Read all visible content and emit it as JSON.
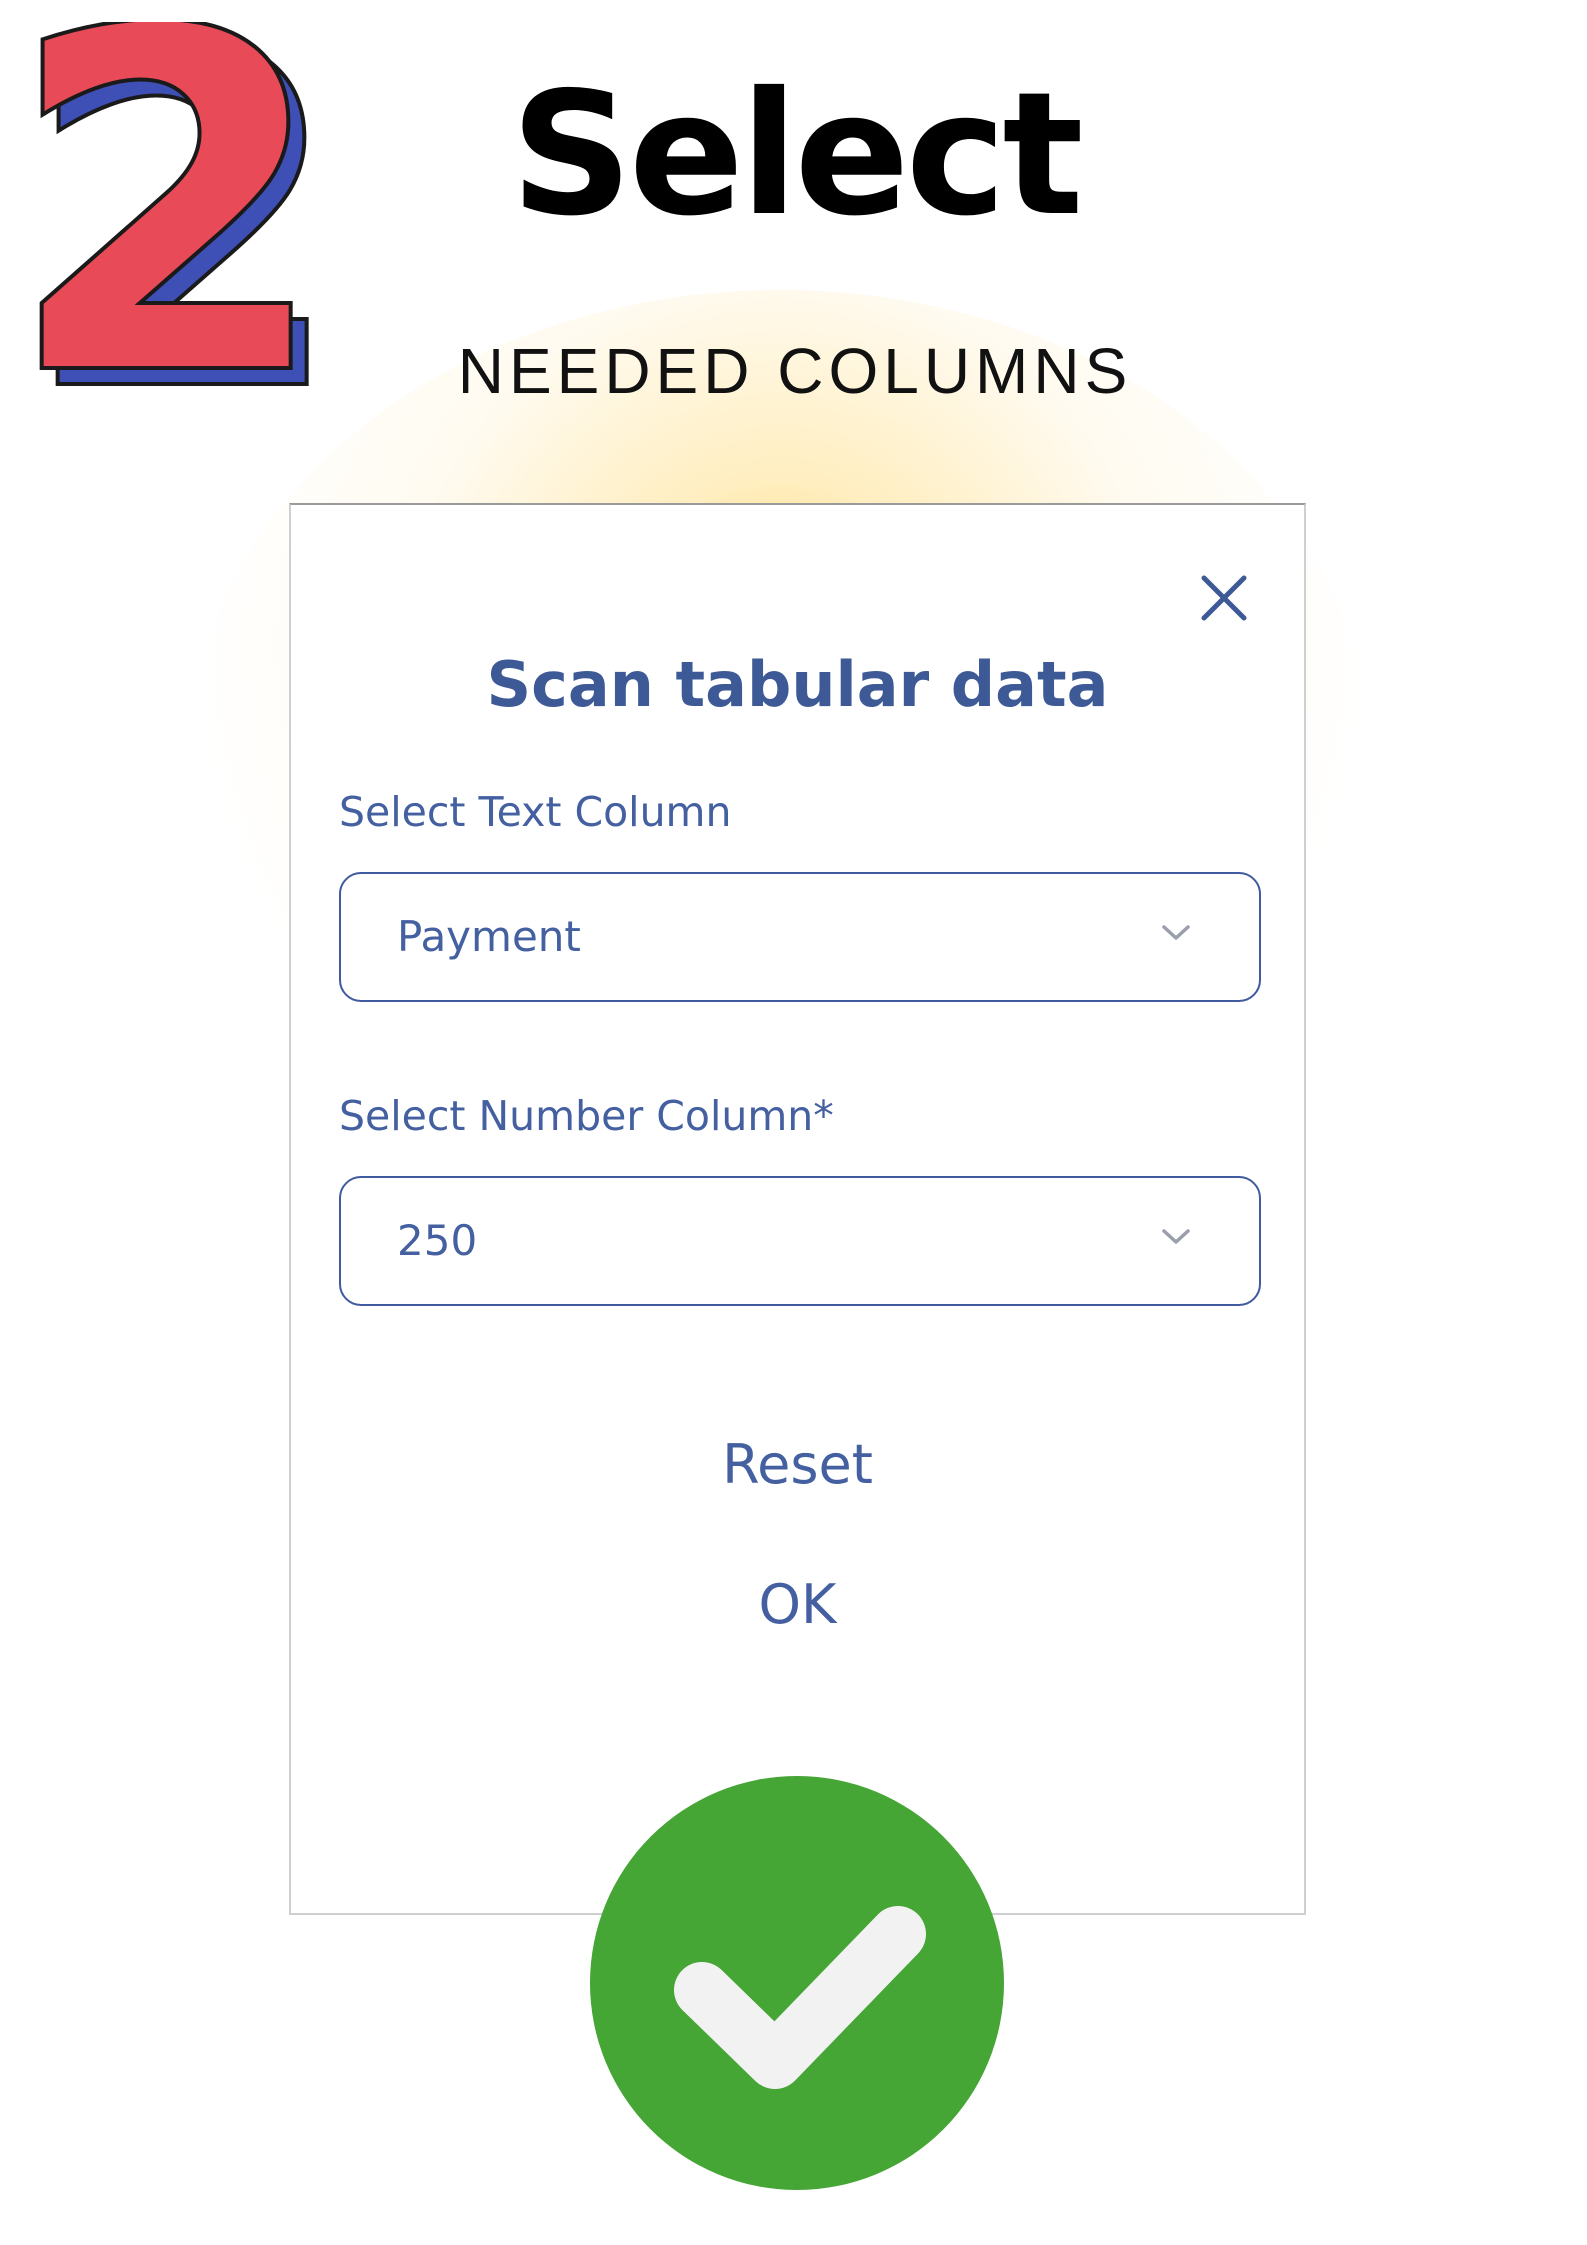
{
  "step": {
    "number": "2",
    "title": "Select",
    "subtitle": "NEEDED COLUMNS"
  },
  "dialog": {
    "title": "Scan tabular data",
    "close_icon": "close-icon",
    "text_column": {
      "label": "Select Text Column",
      "value": "Payment"
    },
    "number_column": {
      "label": "Select Number Column*",
      "value": "250"
    },
    "reset_label": "Reset",
    "ok_label": "OK"
  },
  "badge": {
    "icon": "check-icon",
    "color": "#45a535"
  },
  "colors": {
    "accent": "#4460a0",
    "number_red": "#e84a57",
    "number_shadow": "#3e4fb6",
    "glow": "#ffd65f"
  }
}
